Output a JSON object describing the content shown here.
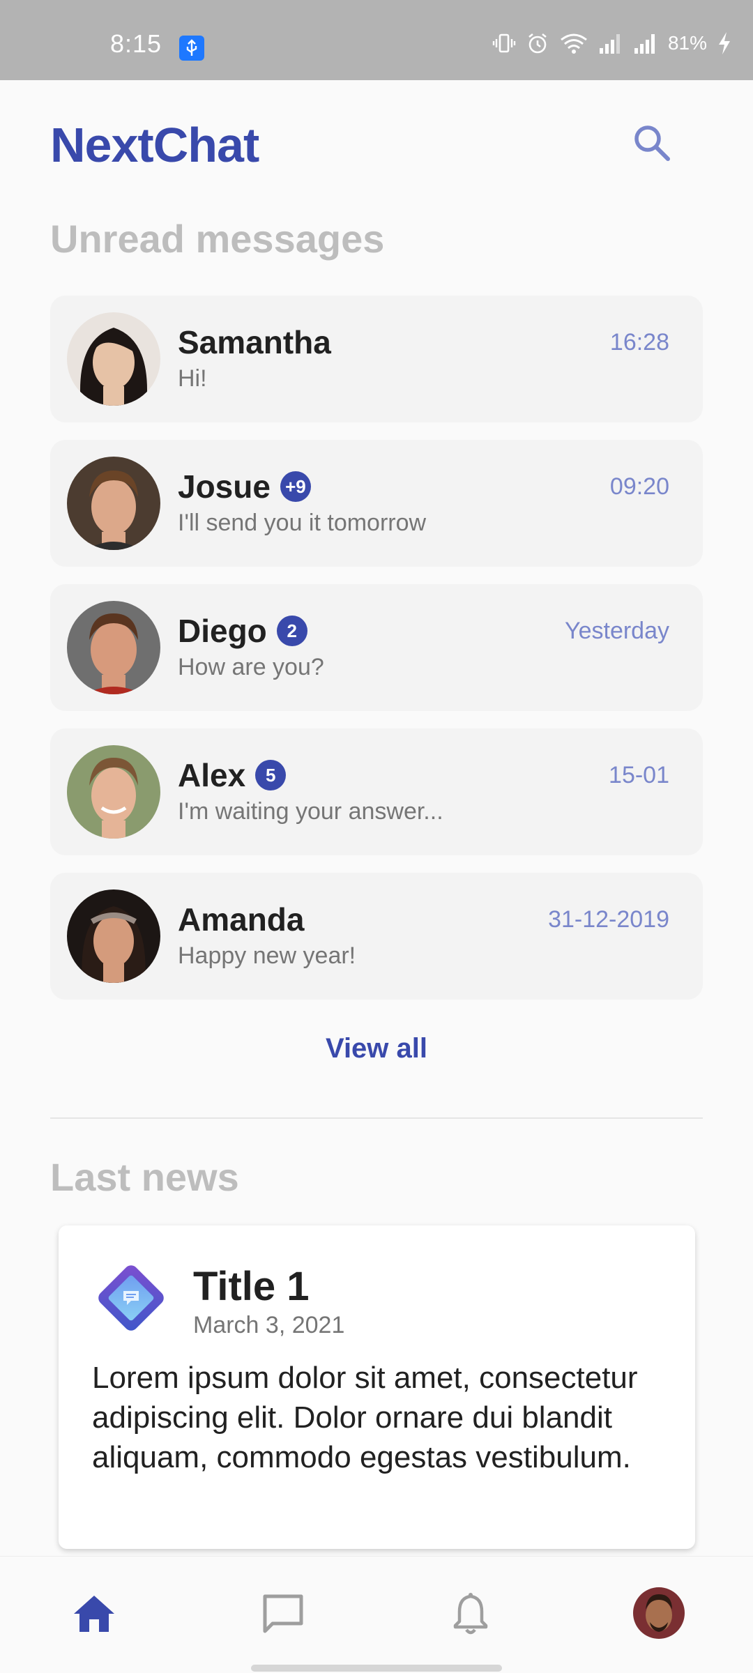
{
  "status_bar": {
    "time": "8:15",
    "battery": "81%",
    "icons": [
      "usb-icon",
      "vibrate-icon",
      "alarm-icon",
      "wifi-icon",
      "signal-icon",
      "signal-icon",
      "charging-icon"
    ]
  },
  "header": {
    "title": "NextChat",
    "search_icon": "search-icon"
  },
  "unread": {
    "title": "Unread messages",
    "chats": [
      {
        "name": "Samantha",
        "badge": "",
        "message": "Hi!",
        "time": "16:28"
      },
      {
        "name": "Josue",
        "badge": "+9",
        "message": "I'll send you it tomorrow",
        "time": "09:20"
      },
      {
        "name": "Diego",
        "badge": "2",
        "message": "How are you?",
        "time": "Yesterday"
      },
      {
        "name": "Alex",
        "badge": "5",
        "message": "I'm waiting your answer...",
        "time": "15-01"
      },
      {
        "name": "Amanda",
        "badge": "",
        "message": "Happy new year!",
        "time": "31-12-2019"
      }
    ],
    "view_all": "View all"
  },
  "news": {
    "title": "Last news",
    "item": {
      "title": "Title 1",
      "date": "March 3, 2021",
      "body": "Lorem ipsum dolor sit amet, consectetur adipiscing elit. Dolor ornare dui blandit aliquam, commodo egestas vestibulum."
    }
  },
  "bottom_nav": {
    "items": [
      "home-icon",
      "chat-icon",
      "bell-icon",
      "profile-avatar"
    ],
    "active": "home-icon"
  },
  "colors": {
    "accent": "#3949ab",
    "accent_light": "#7986cb",
    "section_title": "#bdbdbd",
    "card_bg": "#f3f3f3"
  }
}
